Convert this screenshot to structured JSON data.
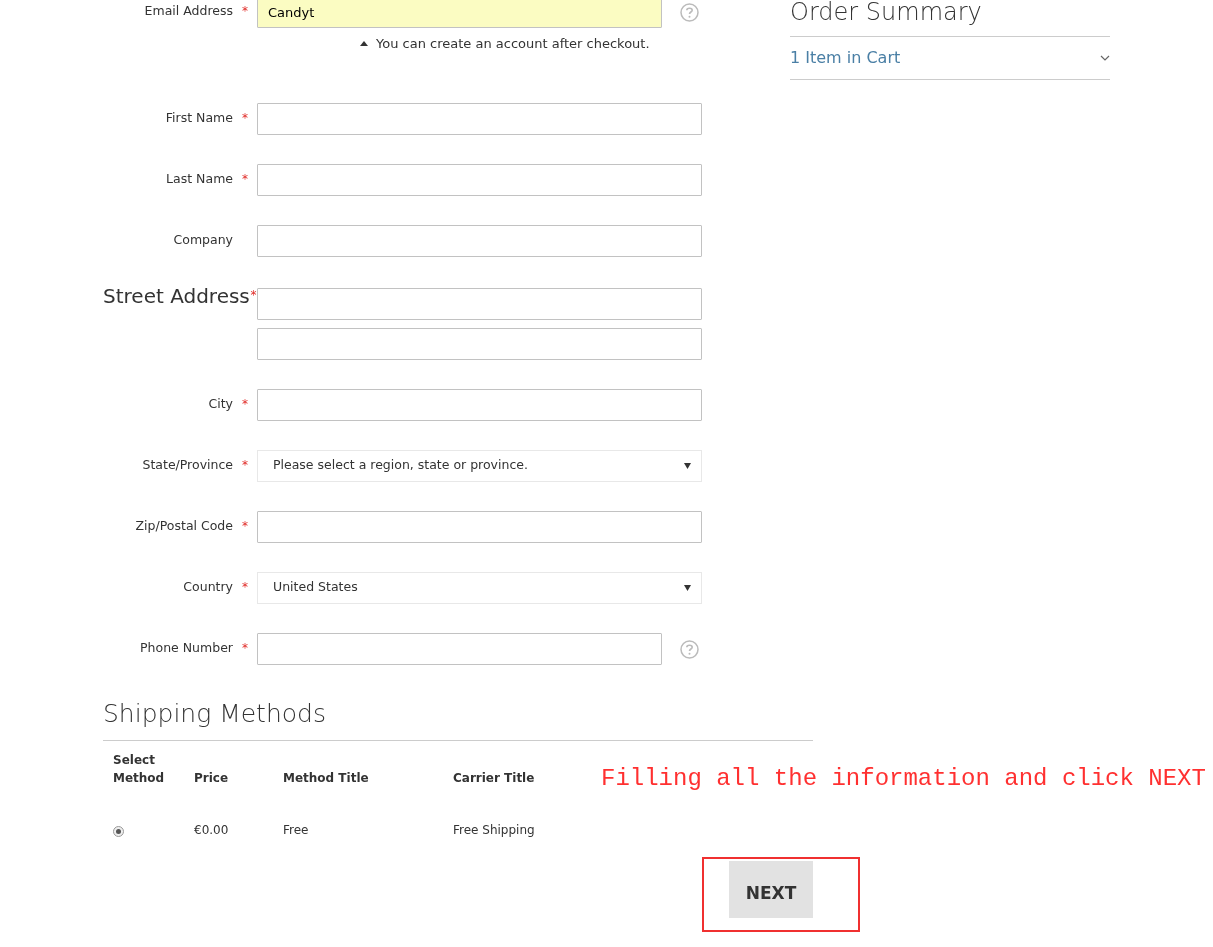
{
  "email": {
    "label": "Email Address",
    "required_mark": "*",
    "value": "Candyt",
    "help": true,
    "note": "You can create an account after checkout."
  },
  "fields": [
    {
      "kind": "text",
      "label": "First Name",
      "required_mark": "*"
    },
    {
      "kind": "text",
      "label": "Last Name",
      "required_mark": "*"
    },
    {
      "kind": "text",
      "label": "Company"
    },
    {
      "kind": "street",
      "label": "Street Address",
      "required_mark": "*"
    },
    {
      "kind": "text",
      "label": "City",
      "required_mark": "*"
    },
    {
      "kind": "select",
      "label": "State/Province",
      "required_mark": "*",
      "value": "Please select a region, state or province."
    },
    {
      "kind": "text",
      "label": "Zip/Postal Code",
      "required_mark": "*"
    },
    {
      "kind": "select",
      "label": "Country",
      "required_mark": "*",
      "value": "United States"
    },
    {
      "kind": "text",
      "label": "Phone Number",
      "required_mark": "*",
      "help": true
    }
  ],
  "shipping": {
    "title": "Shipping Methods",
    "columns": [
      "Select\nMethod",
      "Price",
      "Method Title",
      "Carrier Title"
    ],
    "rows": [
      {
        "selected": true,
        "price": "€0.00",
        "method": "Free",
        "carrier": "Free Shipping"
      }
    ]
  },
  "next_button": "NEXT",
  "annotation": "Filling all the information and click NEXT",
  "order_summary": {
    "title": "Order Summary",
    "cart": "1 Item in Cart",
    "expanded": false
  }
}
